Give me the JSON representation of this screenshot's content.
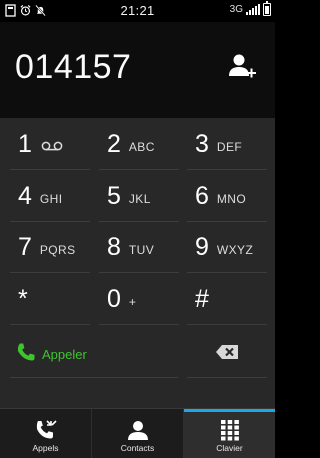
{
  "status": {
    "time": "21:21",
    "network": "3G"
  },
  "display": {
    "number": "014157"
  },
  "keypad": {
    "keys": [
      {
        "digit": "1",
        "letters": ""
      },
      {
        "digit": "2",
        "letters": "ABC"
      },
      {
        "digit": "3",
        "letters": "DEF"
      },
      {
        "digit": "4",
        "letters": "GHI"
      },
      {
        "digit": "5",
        "letters": "JKL"
      },
      {
        "digit": "6",
        "letters": "MNO"
      },
      {
        "digit": "7",
        "letters": "PQRS"
      },
      {
        "digit": "8",
        "letters": "TUV"
      },
      {
        "digit": "9",
        "letters": "WXYZ"
      },
      {
        "digit": "*",
        "letters": ""
      },
      {
        "digit": "0",
        "letters": "+"
      },
      {
        "digit": "#",
        "letters": ""
      }
    ],
    "call_label": "Appeler"
  },
  "tabs": [
    {
      "label": "Appels",
      "icon": "call-log-icon",
      "active": false
    },
    {
      "label": "Contacts",
      "icon": "contact-icon",
      "active": false
    },
    {
      "label": "Clavier",
      "icon": "keypad-icon",
      "active": true
    }
  ],
  "colors": {
    "accent": "#19a9e5",
    "call_green": "#3fc430",
    "keypad_bg": "#282828"
  }
}
